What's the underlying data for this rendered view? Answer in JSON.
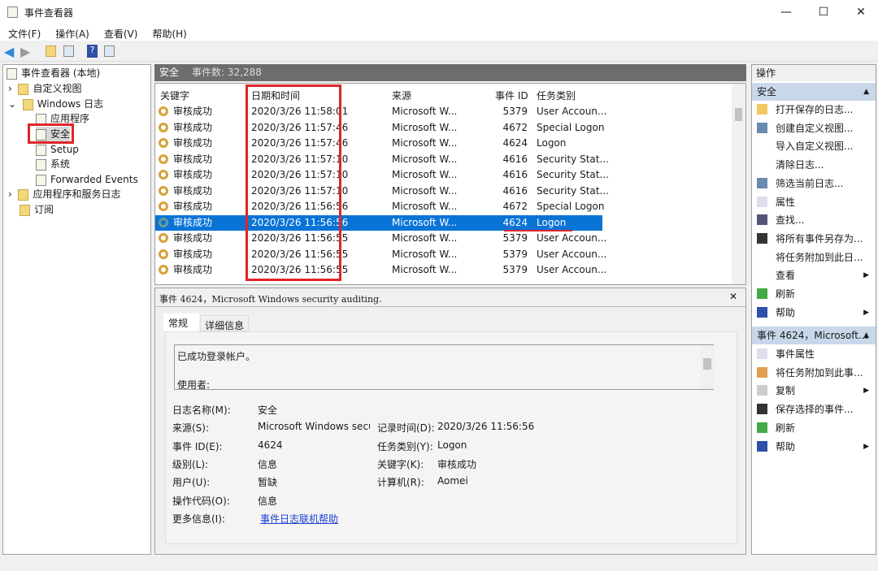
{
  "window": {
    "title": "事件查看器",
    "minimize": "—",
    "maximize": "☐",
    "close": "✕"
  },
  "menu": [
    "文件(F)",
    "操作(A)",
    "查看(V)",
    "帮助(H)"
  ],
  "tree": {
    "root": "事件查看器 (本地)",
    "custom": "自定义视图",
    "windows_logs": "Windows 日志",
    "items": [
      "应用程序",
      "安全",
      "Setup",
      "系统",
      "Forwarded Events"
    ],
    "app_service": "应用程序和服务日志",
    "subscriptions": "订阅"
  },
  "header": {
    "log": "安全",
    "count": "事件数: 32,288"
  },
  "columns": {
    "keyword": "关键字",
    "datetime": "日期和时间",
    "source": "来源",
    "id": "事件 ID",
    "task": "任务类别"
  },
  "rows": [
    {
      "k": "审核成功",
      "d": "2020/3/26 11:58:01",
      "s": "Microsoft W...",
      "id": "5379",
      "t": "User Accoun..."
    },
    {
      "k": "审核成功",
      "d": "2020/3/26 11:57:46",
      "s": "Microsoft W...",
      "id": "4672",
      "t": "Special Logon"
    },
    {
      "k": "审核成功",
      "d": "2020/3/26 11:57:46",
      "s": "Microsoft W...",
      "id": "4624",
      "t": "Logon"
    },
    {
      "k": "审核成功",
      "d": "2020/3/26 11:57:10",
      "s": "Microsoft W...",
      "id": "4616",
      "t": "Security Stat..."
    },
    {
      "k": "审核成功",
      "d": "2020/3/26 11:57:10",
      "s": "Microsoft W...",
      "id": "4616",
      "t": "Security Stat..."
    },
    {
      "k": "审核成功",
      "d": "2020/3/26 11:57:10",
      "s": "Microsoft W...",
      "id": "4616",
      "t": "Security Stat..."
    },
    {
      "k": "审核成功",
      "d": "2020/3/26 11:56:56",
      "s": "Microsoft W...",
      "id": "4672",
      "t": "Special Logon"
    },
    {
      "k": "审核成功",
      "d": "2020/3/26 11:56:56",
      "s": "Microsoft W...",
      "id": "4624",
      "t": "Logon"
    },
    {
      "k": "审核成功",
      "d": "2020/3/26 11:56:55",
      "s": "Microsoft W...",
      "id": "5379",
      "t": "User Accoun..."
    },
    {
      "k": "审核成功",
      "d": "2020/3/26 11:56:55",
      "s": "Microsoft W...",
      "id": "5379",
      "t": "User Accoun..."
    },
    {
      "k": "审核成功",
      "d": "2020/3/26 11:56:55",
      "s": "Microsoft W...",
      "id": "5379",
      "t": "User Accoun..."
    }
  ],
  "detail": {
    "title": "事件 4624，Microsoft Windows security auditing.",
    "tabs": [
      "常规",
      "详细信息"
    ],
    "message": "已成功登录帐户。",
    "message_cut": "使用者:",
    "fields": {
      "log_name_l": "日志名称(M):",
      "log_name": "安全",
      "source_l": "来源(S):",
      "source": "Microsoft Windows secur",
      "recorded_l": "记录时间(D):",
      "recorded": "2020/3/26 11:56:56",
      "id_l": "事件 ID(E):",
      "id": "4624",
      "task_l": "任务类别(Y):",
      "task": "Logon",
      "level_l": "级别(L):",
      "level": "信息",
      "keyword_l": "关键字(K):",
      "keyword": "审核成功",
      "user_l": "用户(U):",
      "user": "暂缺",
      "computer_l": "计算机(R):",
      "computer": "Aomei",
      "opcode_l": "操作代码(O):",
      "opcode": "信息",
      "more_l": "更多信息(I):",
      "more": "事件日志联机帮助"
    }
  },
  "actions": {
    "title": "操作",
    "group1": "安全",
    "g1": [
      "打开保存的日志...",
      "创建自定义视图...",
      "导入自定义视图...",
      "清除日志...",
      "筛选当前日志...",
      "属性",
      "查找...",
      "将所有事件另存为...",
      "将任务附加到此日...",
      "查看",
      "刷新",
      "帮助"
    ],
    "group2": "事件 4624，Microsoft...",
    "g2": [
      "事件属性",
      "将任务附加到此事...",
      "复制",
      "保存选择的事件...",
      "刷新",
      "帮助"
    ]
  }
}
